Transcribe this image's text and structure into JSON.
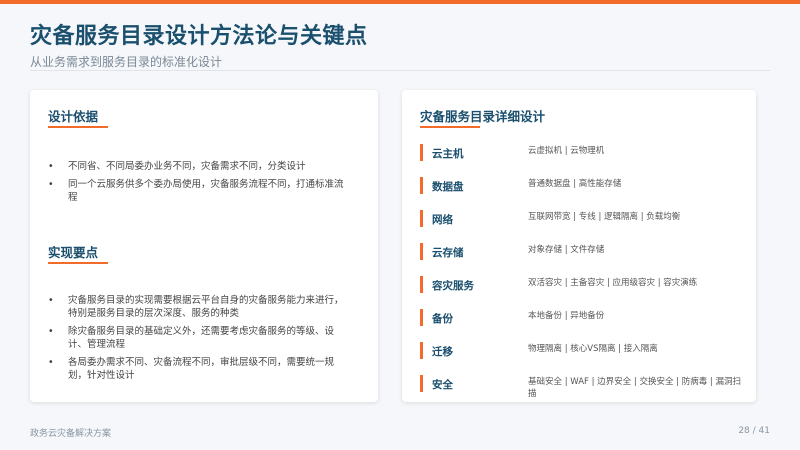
{
  "header": {
    "title": "灾备服务目录设计方法论与关键点",
    "subtitle": "从业务需求到服务目录的标准化设计"
  },
  "left_card": {
    "section1": {
      "heading": "设计依据",
      "bullets": [
        "不同省、不同局委办业务不同，灾备需求不同，分类设计",
        "同一个云服务供多个委办局使用，灾备服务流程不同，打通标准流程"
      ]
    },
    "section2": {
      "heading": "实现要点",
      "bullets": [
        "灾备服务目录的实现需要根据云平台自身的灾备服务能力来进行，特别是服务目录的层次深度、服务的种类",
        "除灾备服务目录的基础定义外，还需要考虑灾备服务的等级、设计、管理流程",
        "各局委办需求不同、灾备流程不同，审批层级不同，需要统一规划，针对性设计"
      ]
    },
    "bullet_symbol": "•"
  },
  "right_card": {
    "heading": "灾备服务目录详细设计",
    "rows": [
      {
        "name": "云主机",
        "desc": "云虚拟机 | 云物理机"
      },
      {
        "name": "数据盘",
        "desc": "普通数据盘 | 高性能存储"
      },
      {
        "name": "网络",
        "desc": "互联网带宽 | 专线 | 逻辑隔离 | 负载均衡"
      },
      {
        "name": "云存储",
        "desc": "对象存储 | 文件存储"
      },
      {
        "name": "容灾服务",
        "desc": "双活容灾 | 主备容灾 | 应用级容灾 | 容灾演练"
      },
      {
        "name": "备份",
        "desc": "本地备份 | 异地备份"
      },
      {
        "name": "迁移",
        "desc": "物理隔离 | 核心VS隔离 | 接入隔离"
      },
      {
        "name": "安全",
        "desc": "基础安全 | WAF | 边界安全 | 交换安全 | 防病毒 | 漏洞扫描"
      }
    ]
  },
  "footer": {
    "left": "政务云灾备解决方案",
    "page": "28 / 41"
  },
  "colors": {
    "accent": "#f26b2a",
    "title": "#1a4f6e",
    "background": "#f5f7fa"
  }
}
